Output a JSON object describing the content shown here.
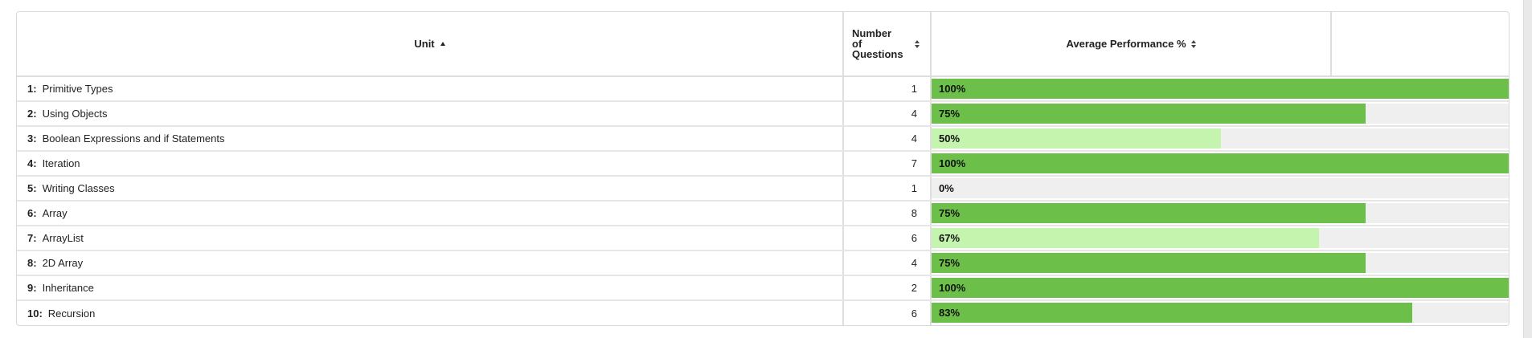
{
  "colors": {
    "high": "#6cc04a",
    "mid": "#c4f4ad",
    "track": "#efefef"
  },
  "table": {
    "columns": {
      "unit": "Unit",
      "num_questions": "Number of Questions",
      "avg_performance": "Average Performance %"
    },
    "rows": [
      {
        "num": "1:",
        "name": "Primitive Types",
        "questions": "1",
        "percent_label": "100%",
        "percent": 100,
        "level": "high"
      },
      {
        "num": "2:",
        "name": "Using Objects",
        "questions": "4",
        "percent_label": "75%",
        "percent": 75,
        "level": "high"
      },
      {
        "num": "3:",
        "name": "Boolean Expressions and if Statements",
        "questions": "4",
        "percent_label": "50%",
        "percent": 50,
        "level": "mid"
      },
      {
        "num": "4:",
        "name": "Iteration",
        "questions": "7",
        "percent_label": "100%",
        "percent": 100,
        "level": "high"
      },
      {
        "num": "5:",
        "name": "Writing Classes",
        "questions": "1",
        "percent_label": "0%",
        "percent": 0,
        "level": "none"
      },
      {
        "num": "6:",
        "name": "Array",
        "questions": "8",
        "percent_label": "75%",
        "percent": 75,
        "level": "high"
      },
      {
        "num": "7:",
        "name": "ArrayList",
        "questions": "6",
        "percent_label": "67%",
        "percent": 67,
        "level": "mid"
      },
      {
        "num": "8:",
        "name": "2D Array",
        "questions": "4",
        "percent_label": "75%",
        "percent": 75,
        "level": "high"
      },
      {
        "num": "9:",
        "name": "Inheritance",
        "questions": "2",
        "percent_label": "100%",
        "percent": 100,
        "level": "high"
      },
      {
        "num": "10:",
        "name": "Recursion",
        "questions": "6",
        "percent_label": "83%",
        "percent": 83,
        "level": "high"
      }
    ]
  }
}
